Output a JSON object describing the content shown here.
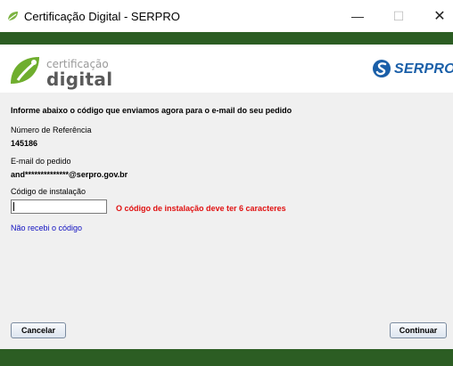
{
  "window": {
    "title": "Certificação Digital - SERPRO",
    "minimize_symbol": "—",
    "maximize_symbol": "☐",
    "close_symbol": "✕"
  },
  "header": {
    "logo_small_text": "certificação",
    "logo_big_text": "digital",
    "brand_text": "SERPRO"
  },
  "form": {
    "instruction": "Informe abaixo o código que enviamos agora para o e-mail do seu pedido",
    "reference_label": "Número de Referência",
    "reference_value": "145186",
    "email_label": "E-mail do pedido",
    "email_value": "and**************@serpro.gov.br",
    "code_label": "Código de instalação",
    "code_value": "",
    "error_message": "O código de instalação deve ter 6 caracteres",
    "resend_link": "Não recebi o código"
  },
  "buttons": {
    "cancel": "Cancelar",
    "continue": "Continuar"
  },
  "colors": {
    "green_band": "#2c5d23",
    "error": "#e01010",
    "link": "#1010c0",
    "brand_blue": "#1a5fa8",
    "logo_green": "#6fae2e"
  }
}
